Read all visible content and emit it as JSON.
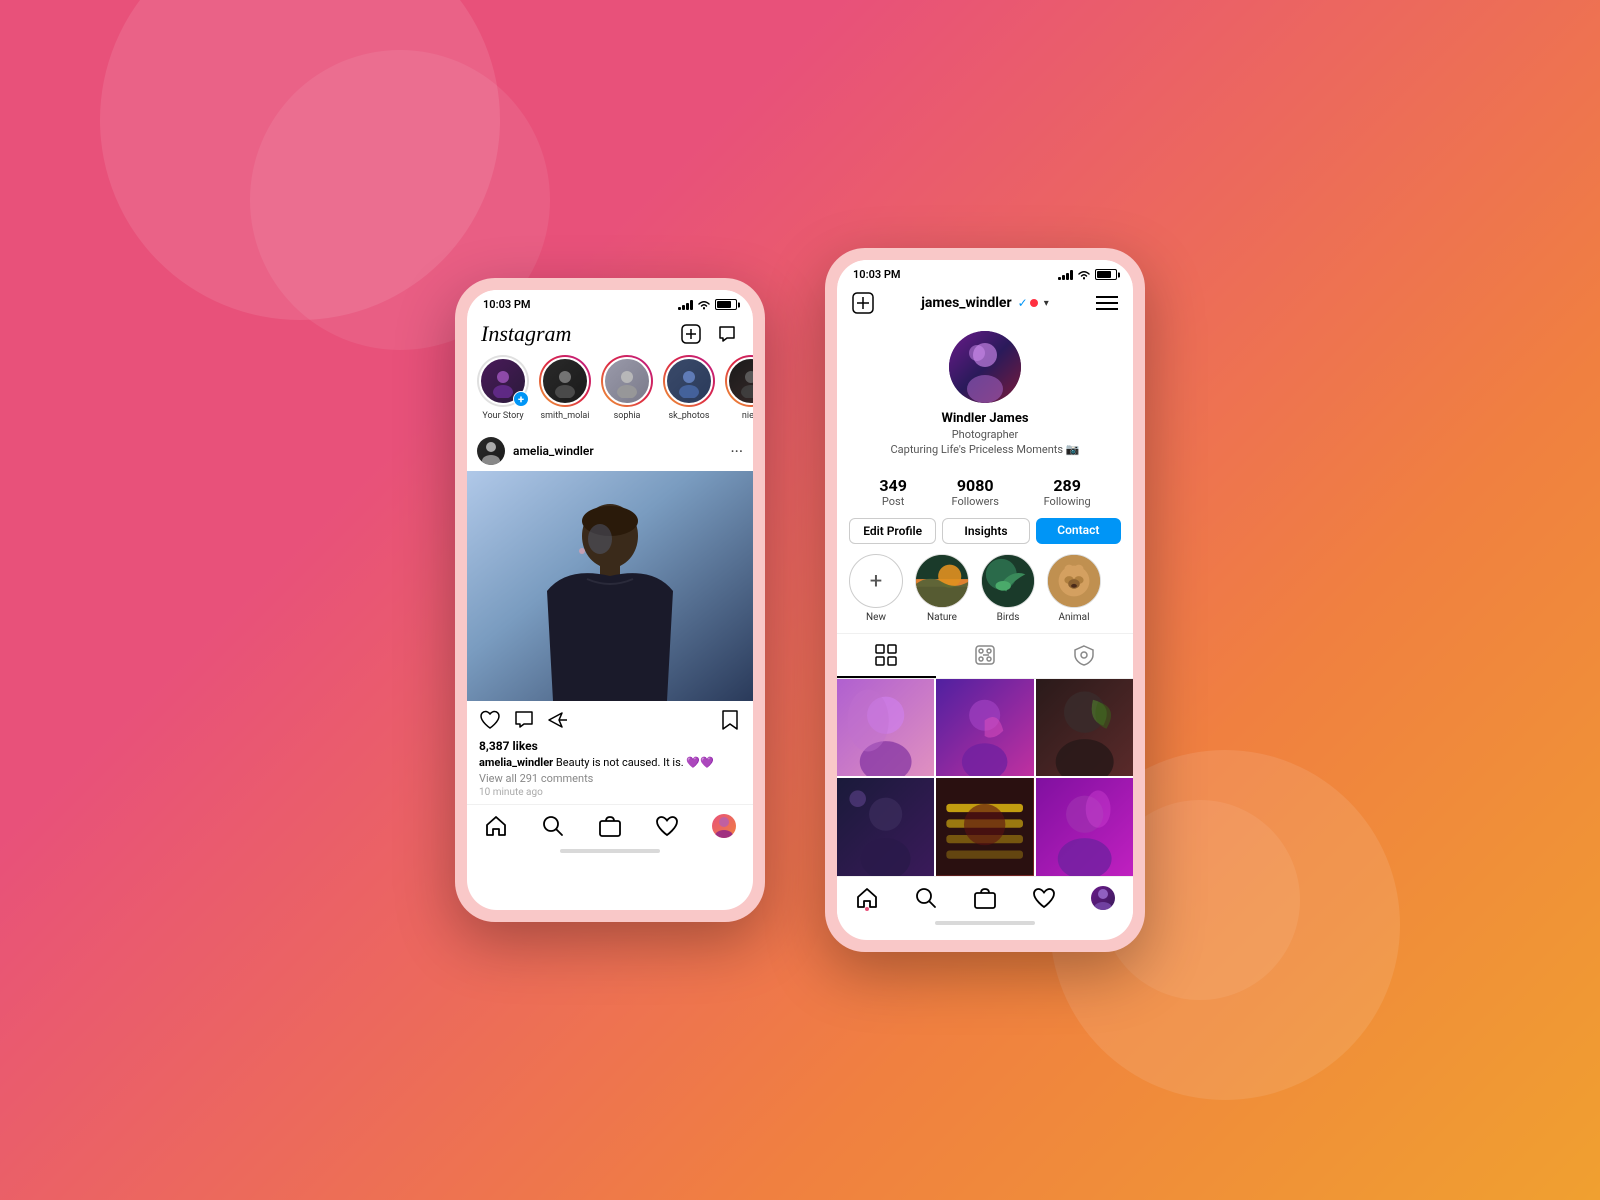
{
  "background": {
    "gradient": "135deg, #e8517a 0%, #e8517a 30%, #f08040 70%, #f0a030 100%"
  },
  "phone1": {
    "statusBar": {
      "time": "10:03 PM"
    },
    "header": {
      "logo": "Instagram",
      "addIcon": "+",
      "messageIcon": "✈"
    },
    "stories": [
      {
        "label": "Your Story",
        "hasRing": false,
        "isYou": true
      },
      {
        "label": "smith_molai",
        "hasRing": true
      },
      {
        "label": "sophia",
        "hasRing": true
      },
      {
        "label": "sk_photos",
        "hasRing": true
      },
      {
        "label": "niel_",
        "hasRing": true
      }
    ],
    "post": {
      "username": "amelia_windler",
      "likes": "8,387 likes",
      "captionUser": "amelia_windler",
      "captionText": " Beauty is not caused. It is. 💜💜",
      "commentsText": "View all 291 comments",
      "timeAgo": "10 minute ago"
    },
    "nav": {
      "items": [
        "home",
        "search",
        "shop",
        "heart",
        "profile"
      ]
    }
  },
  "phone2": {
    "statusBar": {
      "time": "10:03 PM"
    },
    "header": {
      "addIcon": "+",
      "username": "james_windler",
      "menuIcon": "☰"
    },
    "profile": {
      "realName": "Windler James",
      "bioTitle": "Photographer",
      "bio": "Capturing Life's Priceless Moments 📷"
    },
    "stats": {
      "posts": "349",
      "postsLabel": "Post",
      "followers": "9080",
      "followersLabel": "Followers",
      "following": "289",
      "followingLabel": "Following"
    },
    "buttons": {
      "editProfile": "Edit Profile",
      "insights": "Insights",
      "contact": "Contact"
    },
    "highlights": [
      {
        "label": "New",
        "isAdd": true
      },
      {
        "label": "Nature"
      },
      {
        "label": "Birds"
      },
      {
        "label": "Animal"
      }
    ],
    "tabs": [
      "grid",
      "reels",
      "tagged"
    ],
    "photos": [
      {
        "id": 1
      },
      {
        "id": 2
      },
      {
        "id": 3
      },
      {
        "id": 4
      },
      {
        "id": 5
      },
      {
        "id": 6
      }
    ]
  }
}
